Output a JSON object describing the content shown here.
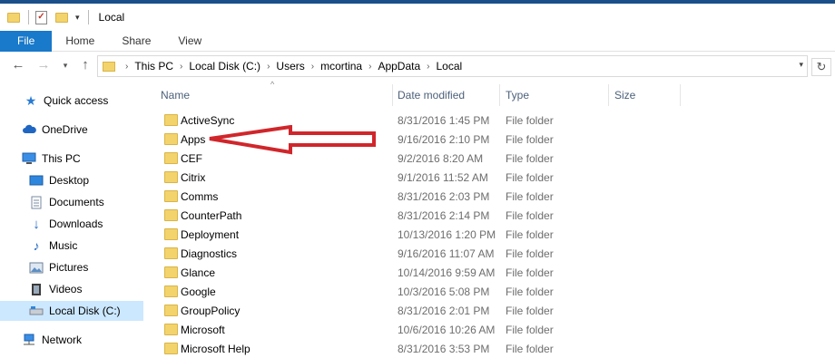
{
  "window": {
    "title": "Local"
  },
  "ribbon": {
    "tabs": [
      "File",
      "Home",
      "Share",
      "View"
    ]
  },
  "address": {
    "crumbs": [
      "This PC",
      "Local Disk (C:)",
      "Users",
      "mcortina",
      "AppData",
      "Local"
    ]
  },
  "nav": {
    "items": [
      {
        "label": "Quick access",
        "icon": "star-icon"
      },
      {
        "label": "OneDrive",
        "icon": "cloud-icon"
      },
      {
        "label": "This PC",
        "icon": "computer-icon"
      },
      {
        "label": "Desktop",
        "icon": "desktop-icon"
      },
      {
        "label": "Documents",
        "icon": "documents-icon"
      },
      {
        "label": "Downloads",
        "icon": "download-icon"
      },
      {
        "label": "Music",
        "icon": "music-icon"
      },
      {
        "label": "Pictures",
        "icon": "pictures-icon"
      },
      {
        "label": "Videos",
        "icon": "videos-icon"
      },
      {
        "label": "Local Disk (C:)",
        "icon": "drive-icon",
        "selected": true
      },
      {
        "label": "Network",
        "icon": "network-icon"
      }
    ]
  },
  "columns": {
    "name": "Name",
    "date": "Date modified",
    "type": "Type",
    "size": "Size"
  },
  "files": [
    {
      "name": "ActiveSync",
      "date": "8/31/2016 1:45 PM",
      "type": "File folder"
    },
    {
      "name": "Apps",
      "date": "9/16/2016 2:10 PM",
      "type": "File folder"
    },
    {
      "name": "CEF",
      "date": "9/2/2016 8:20 AM",
      "type": "File folder"
    },
    {
      "name": "Citrix",
      "date": "9/1/2016 11:52 AM",
      "type": "File folder"
    },
    {
      "name": "Comms",
      "date": "8/31/2016 2:03 PM",
      "type": "File folder"
    },
    {
      "name": "CounterPath",
      "date": "8/31/2016 2:14 PM",
      "type": "File folder"
    },
    {
      "name": "Deployment",
      "date": "10/13/2016 1:20 PM",
      "type": "File folder"
    },
    {
      "name": "Diagnostics",
      "date": "9/16/2016 11:07 AM",
      "type": "File folder"
    },
    {
      "name": "Glance",
      "date": "10/14/2016 9:59 AM",
      "type": "File folder"
    },
    {
      "name": "Google",
      "date": "10/3/2016 5:08 PM",
      "type": "File folder"
    },
    {
      "name": "GroupPolicy",
      "date": "8/31/2016 2:01 PM",
      "type": "File folder"
    },
    {
      "name": "Microsoft",
      "date": "10/6/2016 10:26 AM",
      "type": "File folder"
    },
    {
      "name": "Microsoft Help",
      "date": "8/31/2016 3:53 PM",
      "type": "File folder"
    }
  ],
  "colors": {
    "accent": "#1979ca",
    "selection": "#cce8ff",
    "folder": "#f3d36b",
    "annotation_arrow": "#d0262b"
  }
}
